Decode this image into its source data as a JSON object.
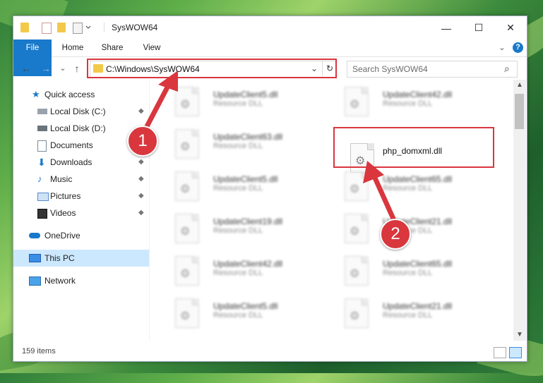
{
  "window": {
    "title": "SysWOW64",
    "controls": {
      "minimize": "—",
      "maximize": "☐",
      "close": "✕"
    }
  },
  "ribbon": {
    "tabs": [
      "File",
      "Home",
      "Share",
      "View"
    ],
    "help": "?",
    "expand": "⌄"
  },
  "navigation": {
    "back": "←",
    "forward": "→",
    "recent": "⌄",
    "up": "↑",
    "address": "C:\\Windows\\SysWOW64",
    "address_dropdown": "⌄",
    "refresh": "↻",
    "search_placeholder": "Search SysWOW64",
    "search_icon": "⌕"
  },
  "sidebar": {
    "items": [
      {
        "label": "Quick access",
        "icon": "star-icon",
        "pinned": false
      },
      {
        "label": "Local Disk (C:)",
        "icon": "drive-icon",
        "pinned": true
      },
      {
        "label": "Local Disk (D:)",
        "icon": "drive-icon",
        "pinned": false
      },
      {
        "label": "Documents",
        "icon": "documents-icon",
        "pinned": true
      },
      {
        "label": "Downloads",
        "icon": "downloads-icon",
        "pinned": true
      },
      {
        "label": "Music",
        "icon": "music-icon",
        "pinned": true
      },
      {
        "label": "Pictures",
        "icon": "pictures-icon",
        "pinned": true
      },
      {
        "label": "Videos",
        "icon": "videos-icon",
        "pinned": true
      },
      {
        "label": "OneDrive",
        "icon": "cloud-icon",
        "pinned": false
      },
      {
        "label": "This PC",
        "icon": "computer-icon",
        "pinned": false,
        "selected": true
      },
      {
        "label": "Network",
        "icon": "network-icon",
        "pinned": false
      }
    ],
    "pin_glyph": "📌"
  },
  "files": {
    "left": [
      {
        "name": "UpdateClient5.dll",
        "desc": "Resource DLL"
      },
      {
        "name": "UpdateClient63.dll",
        "desc": "Resource DLL"
      },
      {
        "name": "UpdateClient5.dll",
        "desc": "Resource DLL"
      },
      {
        "name": "UpdateClient19.dll",
        "desc": "Resource DLL"
      },
      {
        "name": "UpdateClient42.dll",
        "desc": "Resource DLL"
      },
      {
        "name": "UpdateClient5.dll",
        "desc": "Resource DLL"
      }
    ],
    "right": [
      {
        "name": "UpdateClient42.dll",
        "desc": "Resource DLL"
      },
      {
        "name": "php_domxml.dll",
        "desc": ""
      },
      {
        "name": "UpdateClient65.dll",
        "desc": "Resource DLL"
      },
      {
        "name": "UpdateClient21.dll",
        "desc": "Resource DLL"
      },
      {
        "name": "UpdateClient65.dll",
        "desc": "Resource DLL"
      },
      {
        "name": "UpdateClient21.dll",
        "desc": "Resource DLL"
      }
    ]
  },
  "status": {
    "count": "159 items"
  },
  "annotations": {
    "badge1": "1",
    "badge2": "2"
  },
  "colors": {
    "accent": "#1979ca",
    "highlight": "#d9363e",
    "selection": "#cce8ff"
  }
}
